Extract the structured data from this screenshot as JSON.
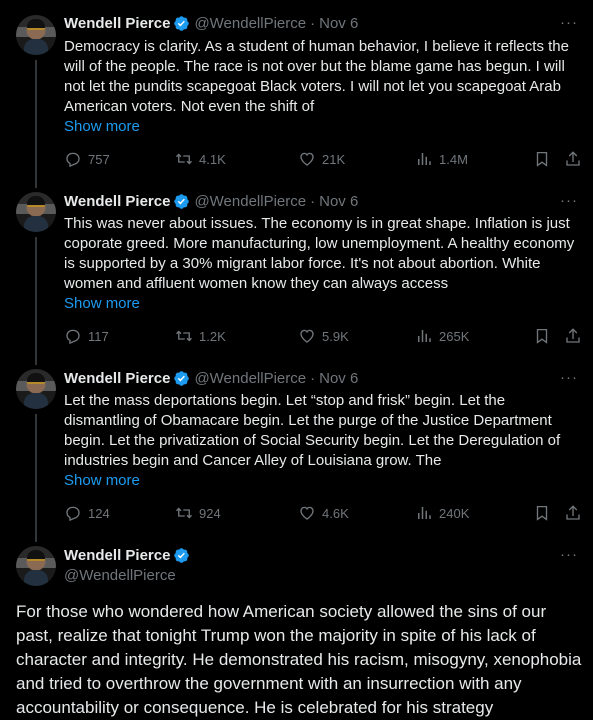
{
  "tweets": [
    {
      "name": "Wendell Pierce",
      "handle": "@WendellPierce",
      "dot": "·",
      "time": "Nov 6",
      "text": "Democracy is clarity. As a student of human behavior, I believe it reflects the will of the people. The race is not over but the blame game has begun. I will not let the pundits scapegoat Black voters. I will not let you scapegoat Arab American voters. Not even the shift of",
      "show_more": "Show more",
      "replies": "757",
      "retweets": "4.1K",
      "likes": "21K",
      "views": "1.4M"
    },
    {
      "name": "Wendell Pierce",
      "handle": "@WendellPierce",
      "dot": "·",
      "time": "Nov 6",
      "text": "This was never about issues. The economy is in great shape. Inflation is just coporate greed. More manufacturing, low unemployment. A healthy economy is supported by a 30% migrant labor force. It's not about abortion. White women and affluent women know they can always access",
      "show_more": "Show more",
      "replies": "117",
      "retweets": "1.2K",
      "likes": "5.9K",
      "views": "265K"
    },
    {
      "name": "Wendell Pierce",
      "handle": "@WendellPierce",
      "dot": "·",
      "time": "Nov 6",
      "text": "Let the mass deportations begin. Let “stop and frisk” begin. Let the dismantling of Obamacare begin. Let the purge of the Justice Department begin. Let the privatization of Social Security begin. Let the Deregulation of industries begin and Cancer Alley of Louisiana grow. The",
      "show_more": "Show more",
      "replies": "124",
      "retweets": "924",
      "likes": "4.6K",
      "views": "240K"
    }
  ],
  "main_tweet": {
    "name": "Wendell Pierce",
    "handle": "@WendellPierce",
    "text": "For those who wondered how American society allowed the sins of our past, realize that tonight Trump won the majority in spite of his lack of character and integrity. He demonstrated his racism, misogyny, xenophobia and tried to overthrow the government with an insurrection with any accountability or consequence. He is celebrated for his strategy"
  },
  "more_glyph": "···",
  "colors": {
    "background": "#000000",
    "text": "#e7e9ea",
    "muted": "#71767b",
    "accent": "#1d9bf0",
    "divider": "#2f3336"
  },
  "icons": [
    "verified-badge-icon",
    "more-icon",
    "reply-icon",
    "retweet-icon",
    "like-icon",
    "views-icon",
    "bookmark-icon",
    "share-icon"
  ]
}
